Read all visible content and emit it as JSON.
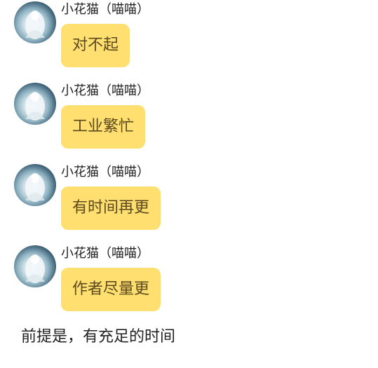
{
  "messages": [
    {
      "sender": "小花猫（喵喵）",
      "text": "对不起"
    },
    {
      "sender": "小花猫（喵喵）",
      "text": "工业繁忙"
    },
    {
      "sender": "小花猫（喵喵）",
      "text": "有时间再更"
    },
    {
      "sender": "小花猫（喵喵）",
      "text": "作者尽量更"
    }
  ],
  "footer_text": "前提是，有充足的时间",
  "colors": {
    "bubble": "#fedf6f",
    "bubble_text": "#5c4a1e",
    "sender_text": "#222222",
    "background": "#ffffff"
  },
  "icons": {
    "avatar": "avatar-icon"
  }
}
